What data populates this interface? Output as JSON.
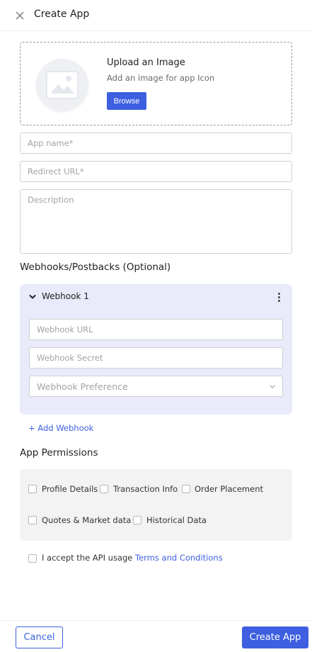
{
  "header": {
    "title": "Create App",
    "close_icon": "close-icon"
  },
  "upload": {
    "title": "Upload an Image",
    "subtitle": "Add an image for app Icon",
    "browse_label": "Browse",
    "icon": "image-placeholder-icon"
  },
  "form": {
    "app_name_placeholder": "App name*",
    "redirect_url_placeholder": "Redirect URL*",
    "description_placeholder": "Description"
  },
  "webhooks": {
    "section_title": "Webhooks/Postbacks (Optional)",
    "items": [
      {
        "title": "Webhook 1",
        "url_placeholder": "Webhook URL",
        "secret_placeholder": "Webhook Secret",
        "preference_placeholder": "Webhook Preference"
      }
    ],
    "add_label": "+ Add Webhook"
  },
  "permissions": {
    "section_title": "App Permissions",
    "items": [
      {
        "label": "Profile Details",
        "checked": false
      },
      {
        "label": "Transaction Info",
        "checked": false
      },
      {
        "label": "Order Placement",
        "checked": false
      },
      {
        "label": "Quotes & Market data",
        "checked": false
      },
      {
        "label": "Historical Data",
        "checked": false
      }
    ]
  },
  "terms": {
    "prefix": "I accept the API usage ",
    "link": "Terms and Conditions",
    "checked": false
  },
  "footer": {
    "cancel_label": "Cancel",
    "create_label": "Create App"
  },
  "colors": {
    "accent": "#3d5fe0",
    "webhook_panel_bg": "#e9ebfa",
    "permissions_bg": "#f3f3f3"
  }
}
